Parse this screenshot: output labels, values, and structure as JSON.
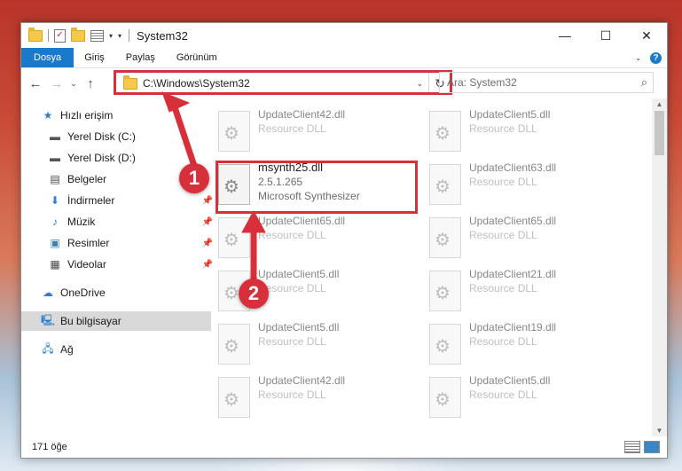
{
  "window": {
    "title": "System32",
    "controls": {
      "minimize": "—",
      "maximize": "☐",
      "close": "✕"
    }
  },
  "ribbon": {
    "tabs": [
      "Dosya",
      "Giriş",
      "Paylaş",
      "Görünüm"
    ]
  },
  "nav": {
    "address": "C:\\Windows\\System32",
    "search_placeholder": "Ara: System32"
  },
  "sidebar": {
    "items": [
      {
        "label": "Hızlı erişim",
        "icon": "star-icon"
      },
      {
        "label": "Yerel Disk (C:)",
        "icon": "drive-icon"
      },
      {
        "label": "Yerel Disk (D:)",
        "icon": "drive-icon"
      },
      {
        "label": "Belgeler",
        "icon": "document-icon"
      },
      {
        "label": "İndirmeler",
        "icon": "download-icon"
      },
      {
        "label": "Müzik",
        "icon": "music-icon"
      },
      {
        "label": "Resimler",
        "icon": "pictures-icon"
      },
      {
        "label": "Videolar",
        "icon": "video-icon"
      },
      {
        "label": "OneDrive",
        "icon": "cloud-icon"
      },
      {
        "label": "Bu bilgisayar",
        "icon": "computer-icon"
      },
      {
        "label": "Ağ",
        "icon": "network-icon"
      }
    ]
  },
  "files": [
    {
      "name": "UpdateClient42.dll",
      "desc": "Resource DLL"
    },
    {
      "name": "UpdateClient5.dll",
      "desc": "Resource DLL"
    },
    {
      "name": "UpdateClient63.dll",
      "desc": "Resource DLL"
    },
    {
      "name": "UpdateClient65.dll",
      "desc": "Resource DLL"
    },
    {
      "name": "UpdateClient65.dll",
      "desc": "Resource DLL"
    },
    {
      "name": "UpdateClient5.dll",
      "desc": "Resource DLL"
    },
    {
      "name": "UpdateClient21.dll",
      "desc": "Resource DLL"
    },
    {
      "name": "UpdateClient5.dll",
      "desc": "Resource DLL"
    },
    {
      "name": "UpdateClient19.dll",
      "desc": "Resource DLL"
    },
    {
      "name": "UpdateClient42.dll",
      "desc": "Resource DLL"
    },
    {
      "name": "UpdateClient5.dll",
      "desc": "Resource DLL"
    }
  ],
  "highlighted_file": {
    "name": "msynth25.dll",
    "version": "2.5.1.265",
    "desc": "Microsoft Synthesizer"
  },
  "status": {
    "count": "171 öğe"
  },
  "callouts": [
    "1",
    "2"
  ],
  "colors": {
    "accent": "#1979ca",
    "highlight": "#d8303a"
  }
}
